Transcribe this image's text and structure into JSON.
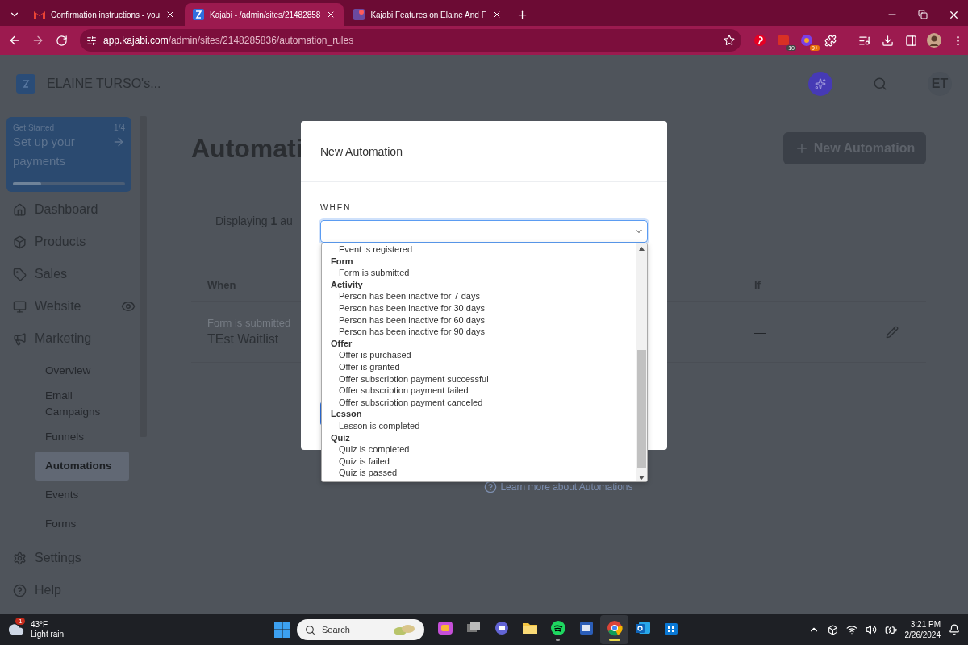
{
  "browser": {
    "tabs": [
      {
        "title": "Confirmation instructions - you",
        "kind": "mail",
        "selected": false
      },
      {
        "title": "Kajabi - /admin/sites/21482858",
        "kind": "kajabi",
        "selected": true
      },
      {
        "title": "Kajabi Features on Elaine And F",
        "kind": "app",
        "selected": false
      }
    ],
    "address": {
      "host": "app.kajabi.com",
      "path": "/admin/sites/2148285836/automation_rules"
    },
    "extension_badges": [
      "10",
      "9+"
    ]
  },
  "header": {
    "site_name": "ELAINE TURSO's...",
    "user_initials": "ET"
  },
  "sidebar": {
    "get_started": {
      "label": "Get Started",
      "step": "1/4",
      "title": "Set up your payments",
      "level": 0.25
    },
    "items": [
      {
        "label": "Dashboard"
      },
      {
        "label": "Products"
      },
      {
        "label": "Sales"
      },
      {
        "label": "Website"
      },
      {
        "label": "Marketing",
        "children": [
          {
            "label": "Overview",
            "selected": false
          },
          {
            "label": "Email Campaigns",
            "selected": false
          },
          {
            "label": "Funnels",
            "selected": false
          },
          {
            "label": "Automations",
            "selected": true
          },
          {
            "label": "Events",
            "selected": false
          },
          {
            "label": "Forms",
            "selected": false
          }
        ]
      }
    ],
    "footer_items": [
      {
        "label": "Settings"
      },
      {
        "label": "Help"
      }
    ]
  },
  "main": {
    "title": "Automati",
    "new_button": "New Automation",
    "displaying": "Displaying **1** au",
    "columns": [
      "When",
      "If"
    ],
    "rows": [
      {
        "trigger": "Form is submitted",
        "name": "TEst Waitlist",
        "condition": "—"
      }
    ],
    "learn_more": "Learn more about Automations"
  },
  "modal": {
    "title": "New Automation",
    "when_label": "WHEN",
    "dropdown_groups": [
      {
        "options": [
          "Event is registered"
        ]
      },
      {
        "label": "Form",
        "options": [
          "Form is submitted"
        ]
      },
      {
        "label": "Activity",
        "options": [
          "Person has been inactive for 7 days",
          "Person has been inactive for 30 days",
          "Person has been inactive for 60 days",
          "Person has been inactive for 90 days"
        ]
      },
      {
        "label": "Offer",
        "options": [
          "Offer is purchased",
          "Offer is granted",
          "Offer subscription payment successful",
          "Offer subscription payment failed",
          "Offer subscription payment canceled"
        ]
      },
      {
        "label": "Lesson",
        "options": [
          "Lesson is completed"
        ]
      },
      {
        "label": "Quiz",
        "options": [
          "Quiz is completed",
          "Quiz is failed",
          "Quiz is passed"
        ]
      }
    ]
  },
  "taskbar": {
    "weather": {
      "badge": "1",
      "temperature": "43°F",
      "condition": "Light rain"
    },
    "search_placeholder": "Search",
    "apps": [
      {
        "running": false,
        "selected": false
      },
      {
        "running": false,
        "selected": false
      },
      {
        "running": false,
        "selected": false
      },
      {
        "running": false,
        "selected": false
      },
      {
        "running": true,
        "selected": false
      },
      {
        "running": false,
        "selected": false
      },
      {
        "running": true,
        "selected": true
      },
      {
        "running": false,
        "selected": false
      },
      {
        "running": false,
        "selected": false
      }
    ],
    "time": "3:21 PM",
    "date": "2/26/2024"
  }
}
